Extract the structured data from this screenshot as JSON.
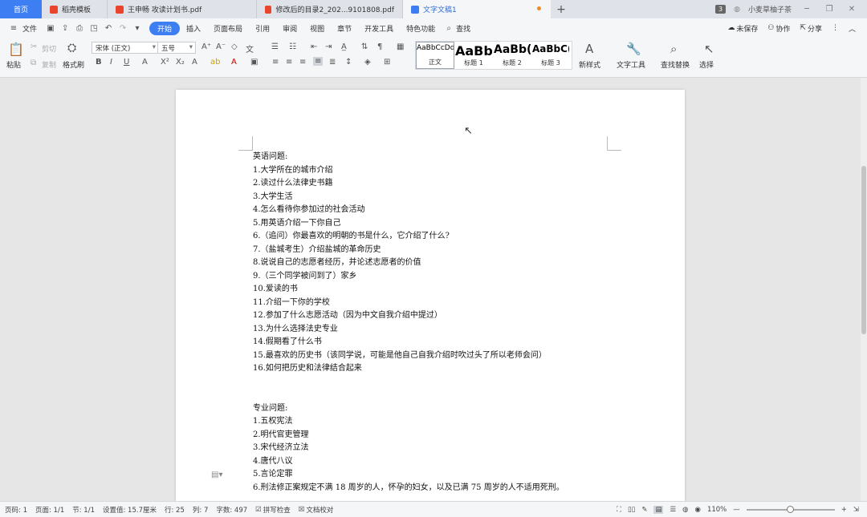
{
  "tabs": [
    {
      "label": "首页",
      "kind": "home"
    },
    {
      "label": "稻壳模板",
      "kind": "doc",
      "icon_color": "#e8452c"
    },
    {
      "label": "王申畅 攻读计划书.pdf",
      "kind": "doc",
      "icon_color": "#e8452c"
    },
    {
      "label": "修改后的目录2_202...9101808.pdf",
      "kind": "doc",
      "icon_color": "#e8452c"
    },
    {
      "label": "文字文稿1",
      "kind": "active",
      "icon_color": "#3d7ff3"
    }
  ],
  "tab_right": {
    "count": "3",
    "user": "小麦草柚子茶"
  },
  "menu": {
    "file": "文件",
    "items": [
      "开始",
      "插入",
      "页面布局",
      "引用",
      "审阅",
      "视图",
      "章节",
      "开发工具",
      "特色功能"
    ],
    "search": "查找",
    "right": [
      "未保存",
      "协作",
      "分享"
    ]
  },
  "ribbon": {
    "paste": "粘贴",
    "cut": "剪切",
    "copy": "复制",
    "format_painter": "格式刷",
    "font_name": "宋体 (正文)",
    "font_size": "五号",
    "styles": [
      {
        "preview": "AaBbCcDd",
        "label": "正文"
      },
      {
        "preview": "AaBb",
        "label": "标题 1"
      },
      {
        "preview": "AaBb(",
        "label": "标题 2"
      },
      {
        "preview": "AaBbC(",
        "label": "标题 3"
      }
    ],
    "new_style": "新样式",
    "text_tools": "文字工具",
    "find_replace": "查找替换",
    "select": "选择"
  },
  "document": {
    "section1_title": "英语问题:",
    "section1": [
      "1.大学所在的城市介绍",
      "2.读过什么法律史书籍",
      "3.大学生活",
      "4.怎么看待你参加过的社会活动",
      "5.用英语介绍一下你自己",
      "6.（追问）你最喜欢的明朝的书是什么，它介绍了什么?",
      "7.（盐城考生）介绍盐城的革命历史",
      "8.说说自己的志愿者经历，并论述志愿者的价值",
      "9.（三个同学被问到了）家乡",
      "10.爱读的书",
      "11.介绍一下你的学校",
      "12.参加了什么志愿活动（因为中文自我介绍中提过）",
      "13.为什么选择法史专业",
      "14.假期看了什么书",
      "15.最喜欢的历史书（该同学说，可能是他自己自我介绍时吹过头了所以老师会问）",
      "16.如何把历史和法律结合起来"
    ],
    "section2_title": "专业问题:",
    "section2": [
      "1.五权宪法",
      "2.明代官吏管理",
      "3.宋代经济立法",
      "4.唐代八议",
      "5.言论定罪",
      "6.刑法修正案规定不满 18 周岁的人，怀孕的妇女，以及已满 75 周岁的人不适用死刑。"
    ]
  },
  "status": {
    "page_num": "页码: 1",
    "pages": "页面: 1/1",
    "section": "节: 1/1",
    "setting": "设置值: 15.7厘米",
    "row": "行: 25",
    "col": "列: 7",
    "words": "字数: 497",
    "spell": "拼写检查",
    "proof": "文档校对",
    "zoom": "110%"
  }
}
